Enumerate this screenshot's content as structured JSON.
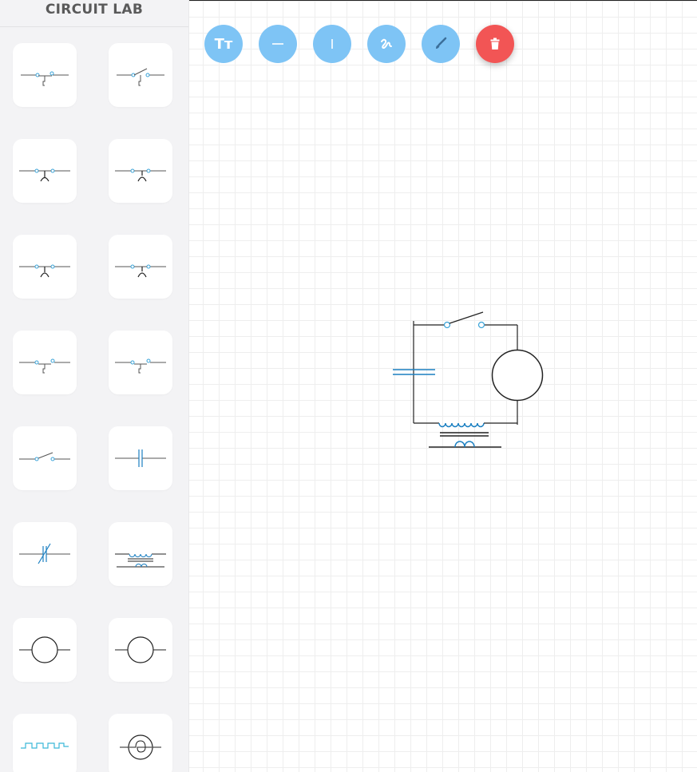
{
  "app": {
    "title": "CIRCUIT LAB"
  },
  "toolbar": {
    "tools": [
      {
        "name": "text",
        "glyph": "Tт",
        "icon": "text-size-icon"
      },
      {
        "name": "horizontal-line",
        "glyph": "—",
        "icon": "horizontal-line-icon"
      },
      {
        "name": "vertical-line",
        "glyph": "|",
        "icon": "vertical-line-icon"
      },
      {
        "name": "freehand",
        "icon": "squiggle-icon"
      },
      {
        "name": "brush",
        "icon": "brush-icon"
      },
      {
        "name": "delete",
        "icon": "trash-icon"
      }
    ]
  },
  "palette": {
    "components": [
      "switch-pushbutton-open",
      "switch-pushbutton-angled",
      "contact-arc",
      "contact-arc-alt",
      "contact-arc-2",
      "contact-arc-3",
      "switch-pushbutton-2",
      "switch-pushbutton-3",
      "switch-knife",
      "capacitor",
      "variable-capacitor",
      "transformer",
      "circle-source",
      "circle-source-2",
      "pulse-waveform",
      "lamp"
    ]
  },
  "colors": {
    "tool_blue": "#7ec4f5",
    "delete_red": "#f25555",
    "component_blue": "#1a7fc1",
    "pin_cyan": "#3aa3d8"
  }
}
